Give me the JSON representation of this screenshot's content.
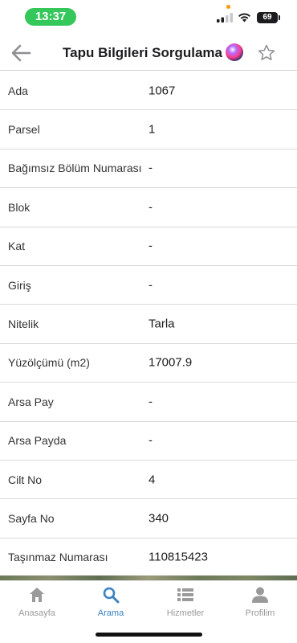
{
  "status_bar": {
    "time": "13:37",
    "battery": "69"
  },
  "nav": {
    "title": "Tapu Bilgileri Sorgulama",
    "icons": [
      "back-arrow-icon",
      "siri-icon",
      "star-icon"
    ]
  },
  "rows": [
    {
      "label": "Ada",
      "value": "1067"
    },
    {
      "label": "Parsel",
      "value": "1"
    },
    {
      "label": "Bağımsız Bölüm Numarası",
      "value": "-"
    },
    {
      "label": "Blok",
      "value": "-"
    },
    {
      "label": "Kat",
      "value": "-"
    },
    {
      "label": "Giriş",
      "value": "-"
    },
    {
      "label": "Nitelik",
      "value": "Tarla"
    },
    {
      "label": "Yüzölçümü (m2)",
      "value": "17007.9"
    },
    {
      "label": "Arsa Pay",
      "value": "-"
    },
    {
      "label": "Arsa Payda",
      "value": "-"
    },
    {
      "label": "Cilt No",
      "value": "4"
    },
    {
      "label": "Sayfa No",
      "value": "340"
    },
    {
      "label": "Taşınmaz Numarası",
      "value": "110815423"
    }
  ],
  "tabs": [
    {
      "label": "Anasayfa",
      "icon": "home-icon",
      "active": false
    },
    {
      "label": "Arama",
      "icon": "search-icon",
      "active": true
    },
    {
      "label": "Hizmetler",
      "icon": "list-icon",
      "active": false
    },
    {
      "label": "Profilim",
      "icon": "person-icon",
      "active": false
    }
  ],
  "colors": {
    "time_pill": "#34c759",
    "active_tab": "#3a82c4",
    "inactive_tab": "#9a9a9a"
  }
}
